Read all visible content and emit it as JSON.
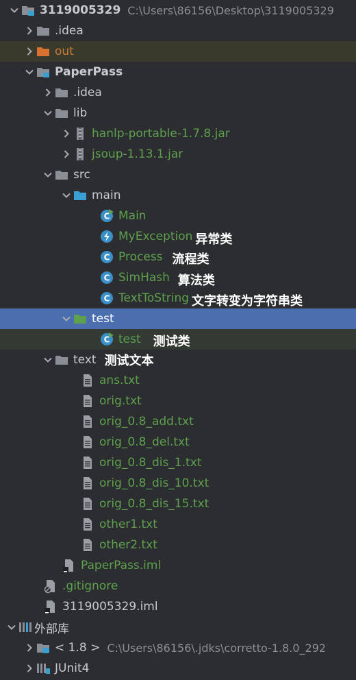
{
  "project_tree": {
    "root": {
      "name": "3119005329",
      "path": "C:\\Users\\86156\\Desktop\\3119005329"
    },
    "idea_top": ".idea",
    "out": "out",
    "paperpass": "PaperPass",
    "pp_idea": ".idea",
    "lib": "lib",
    "jar1": "hanlp-portable-1.7.8.jar",
    "jar2": "jsoup-1.13.1.jar",
    "src": "src",
    "main": "main",
    "main_class": "Main",
    "myexception": "MyException",
    "myexception_note": "异常类",
    "process": "Process",
    "process_note": "流程类",
    "simhash": "SimHash",
    "simhash_note": "算法类",
    "texttostring": "TextToString",
    "texttostring_note": "文字转变为字符串类",
    "test_dir": "test",
    "test_class": "test",
    "test_note": "测试类",
    "text_dir": "text",
    "text_note": "测试文本",
    "files": [
      "ans.txt",
      "orig.txt",
      "orig_0.8_add.txt",
      "orig_0.8_del.txt",
      "orig_0.8_dis_1.txt",
      "orig_0.8_dis_10.txt",
      "orig_0.8_dis_15.txt",
      "other1.txt",
      "other2.txt"
    ],
    "pp_iml": "PaperPass.iml",
    "gitignore": ".gitignore",
    "root_iml": "3119005329.iml"
  },
  "external_libs": {
    "title": "外部库",
    "jdk": {
      "name": "< 1.8 >",
      "path": "C:\\Users\\86156\\.jdks\\corretto-1.8.0_292"
    },
    "junit": "JUnit4"
  }
}
